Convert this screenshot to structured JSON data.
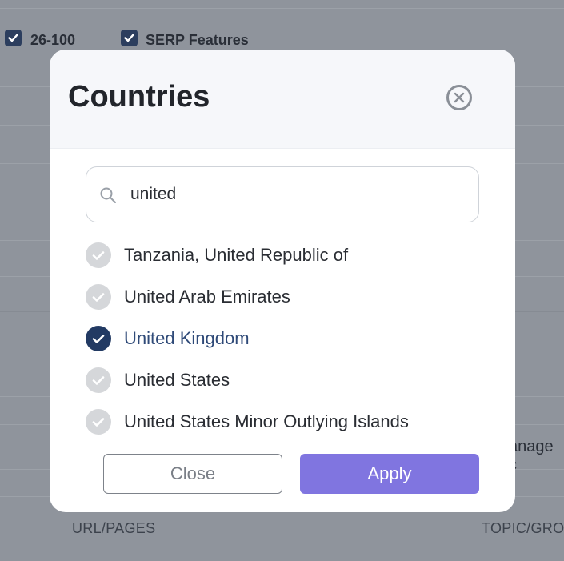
{
  "background": {
    "filters": [
      {
        "label": "26-100",
        "checked": true
      },
      {
        "label": "SERP Features",
        "checked": true
      }
    ],
    "partial_text": "anage c",
    "columns": [
      "URL/PAGES",
      "TOPIC/GRO"
    ]
  },
  "modal": {
    "title": "Countries",
    "search": {
      "value": "united",
      "placeholder": ""
    },
    "items": [
      {
        "label": "Tanzania, United Republic of",
        "checked": false
      },
      {
        "label": "United Arab Emirates",
        "checked": false
      },
      {
        "label": "United Kingdom",
        "checked": true
      },
      {
        "label": "United States",
        "checked": false
      },
      {
        "label": "United States Minor Outlying Islands",
        "checked": false
      }
    ],
    "close_label": "Close",
    "apply_label": "Apply"
  },
  "colors": {
    "accent": "#8075e0",
    "checked": "#223a63",
    "overlay": "#8f949c"
  }
}
